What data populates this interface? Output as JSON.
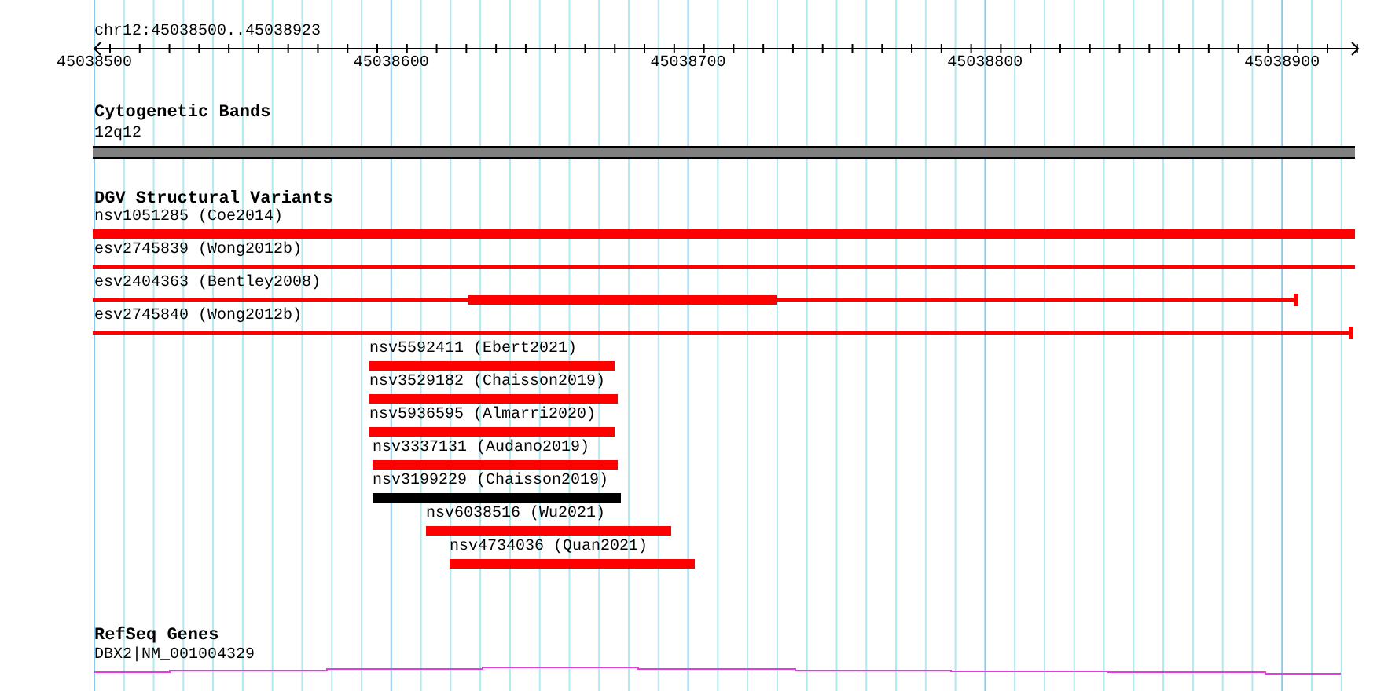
{
  "ruler": {
    "label": "chr12:45038500..45038923",
    "ticks": [
      "45038500",
      "45038600",
      "45038700",
      "45038800",
      "45038900"
    ]
  },
  "tracks": [
    {
      "kind": "bands",
      "title": "Cytogenetic Bands",
      "features": [
        {
          "label": "12q12"
        }
      ]
    },
    {
      "kind": "variants",
      "title": "DGV Structural Variants",
      "features": [
        {
          "label": "nsv1051285 (Coe2014)",
          "color": "#ff0000"
        },
        {
          "label": "esv2745839 (Wong2012b)",
          "color": "#ff0000"
        },
        {
          "label": "esv2404363 (Bentley2008)",
          "color": "#ff0000"
        },
        {
          "label": "esv2745840 (Wong2012b)",
          "color": "#ff0000"
        },
        {
          "label": "nsv5592411 (Ebert2021)",
          "color": "#ff0000"
        },
        {
          "label": "nsv3529182 (Chaisson2019)",
          "color": "#ff0000"
        },
        {
          "label": "nsv5936595 (Almarri2020)",
          "color": "#ff0000"
        },
        {
          "label": "nsv3337131 (Audano2019)",
          "color": "#ff0000"
        },
        {
          "label": "nsv3199229 (Chaisson2019)",
          "color": "#000000"
        },
        {
          "label": "nsv6038516 (Wu2021)",
          "color": "#ff0000"
        },
        {
          "label": "nsv4734036 (Quan2021)",
          "color": "#ff0000"
        }
      ]
    },
    {
      "kind": "genes",
      "title": "RefSeq Genes",
      "features": [
        {
          "label": "DBX2|NM_001004329"
        }
      ]
    }
  ]
}
